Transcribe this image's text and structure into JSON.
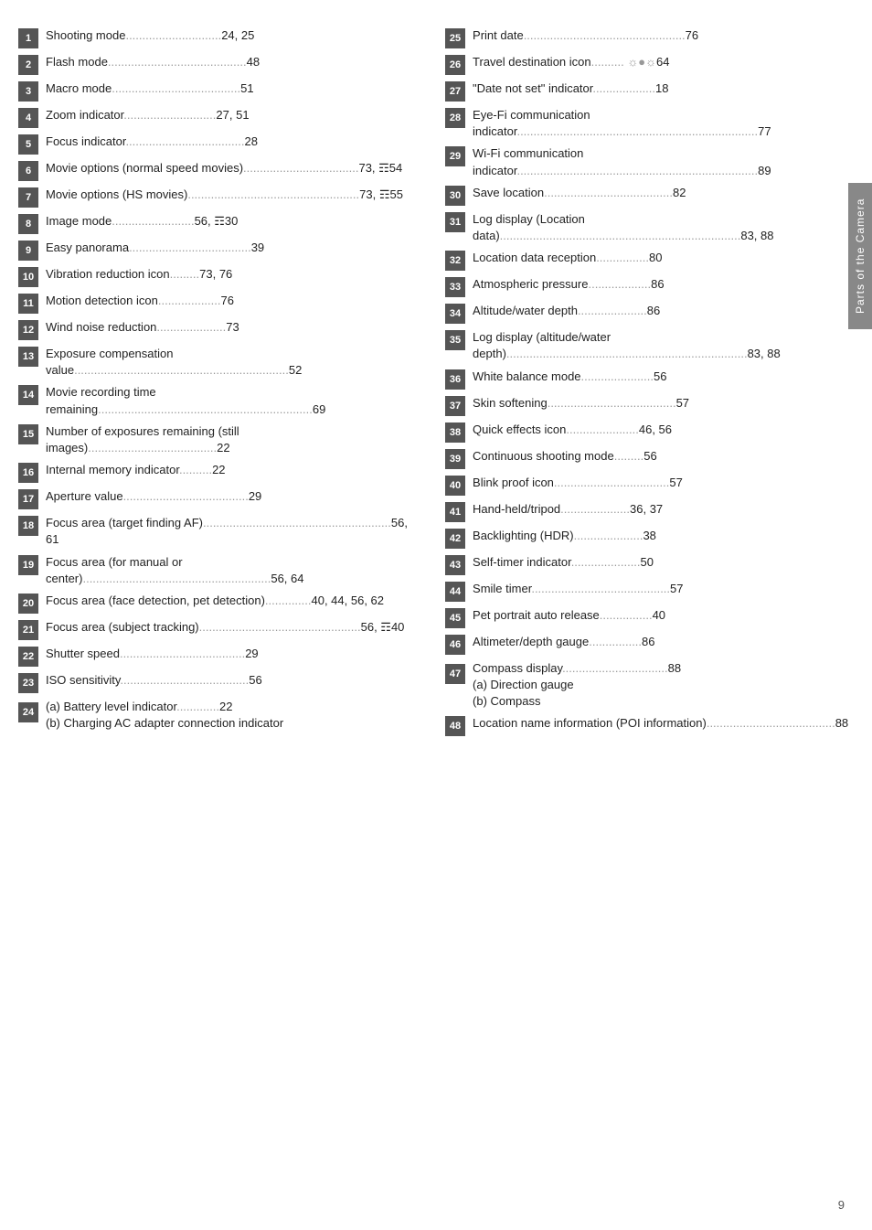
{
  "sidebar_label": "Parts of the Camera",
  "page_number": "9",
  "left_entries": [
    {
      "num": "1",
      "text": "Shooting mode",
      "dots": ".............................",
      "page": "24, 25"
    },
    {
      "num": "2",
      "text": "Flash mode",
      "dots": "..........................................",
      "page": "48"
    },
    {
      "num": "3",
      "text": "Macro mode",
      "dots": ".......................................",
      "page": "51"
    },
    {
      "num": "4",
      "text": "Zoom indicator",
      "dots": "............................",
      "page": "27, 51"
    },
    {
      "num": "5",
      "text": "Focus indicator",
      "dots": "....................................",
      "page": "28"
    },
    {
      "num": "6",
      "text": "Movie options (normal speed movies)",
      "dots": "...................................",
      "page": "73, ☶54"
    },
    {
      "num": "7",
      "text": "Movie options (HS movies)",
      "dots": "....................................................",
      "page": "73, ☶55"
    },
    {
      "num": "8",
      "text": "Image mode",
      "dots": ".........................",
      "page": "56, ☶30"
    },
    {
      "num": "9",
      "text": "Easy panorama",
      "dots": ".....................................",
      "page": "39"
    },
    {
      "num": "10",
      "text": "Vibration reduction icon",
      "dots": ".........",
      "page": "73, 76"
    },
    {
      "num": "11",
      "text": "Motion detection icon",
      "dots": "...................",
      "page": "76"
    },
    {
      "num": "12",
      "text": "Wind noise reduction",
      "dots": ".....................",
      "page": "73"
    },
    {
      "num": "13",
      "text": "Exposure compensation value",
      "dots": ".................................................................",
      "page": "52"
    },
    {
      "num": "14",
      "text": "Movie recording time remaining",
      "dots": ".................................................................",
      "page": "69"
    },
    {
      "num": "15",
      "text": "Number of exposures remaining (still images)",
      "dots": ".......................................",
      "page": "22"
    },
    {
      "num": "16",
      "text": "Internal memory indicator",
      "dots": "..........",
      "page": "22"
    },
    {
      "num": "17",
      "text": "Aperture value",
      "dots": "......................................",
      "page": "29"
    },
    {
      "num": "18",
      "text": "Focus area (target finding AF)",
      "dots": ".........................................................",
      "page": "56, 61"
    },
    {
      "num": "19",
      "text": "Focus area (for manual or center)",
      "dots": ".........................................................",
      "page": "56, 64"
    },
    {
      "num": "20",
      "text": "Focus area (face detection, pet detection)",
      "dots": "..............",
      "page": "40, 44, 56, 62"
    },
    {
      "num": "21",
      "text": "Focus area (subject tracking)",
      "dots": ".................................................",
      "page": "56, ☶40"
    },
    {
      "num": "22",
      "text": "Shutter speed",
      "dots": "......................................",
      "page": "29"
    },
    {
      "num": "23",
      "text": "ISO sensitivity",
      "dots": ".......................................",
      "page": "56"
    },
    {
      "num": "24",
      "text": "(a) Battery level indicator ............. 22\n(b) Charging AC adapter connection indicator",
      "dots": "",
      "page": ""
    }
  ],
  "right_entries": [
    {
      "num": "25",
      "text": "Print date",
      "dots": ".................................................",
      "page": "76"
    },
    {
      "num": "26",
      "text": "Travel destination icon",
      "dots": ".......... ☼●☼",
      "page": "64"
    },
    {
      "num": "27",
      "text": "\"Date not set\" indicator",
      "dots": "...................",
      "page": "18"
    },
    {
      "num": "28",
      "text": "Eye-Fi communication indicator",
      "dots": ".........................................................................",
      "page": "77"
    },
    {
      "num": "29",
      "text": "Wi-Fi communication indicator",
      "dots": ".........................................................................",
      "page": "89"
    },
    {
      "num": "30",
      "text": "Save location",
      "dots": ".......................................",
      "page": "82"
    },
    {
      "num": "31",
      "text": "Log display (Location data)",
      "dots": ".........................................................................",
      "page": "83, 88"
    },
    {
      "num": "32",
      "text": "Location data reception",
      "dots": "................",
      "page": "80"
    },
    {
      "num": "33",
      "text": "Atmospheric pressure",
      "dots": "...................",
      "page": "86"
    },
    {
      "num": "34",
      "text": "Altitude/water depth",
      "dots": ".....................",
      "page": "86"
    },
    {
      "num": "35",
      "text": "Log display (altitude/water depth)",
      "dots": ".........................................................................",
      "page": "83, 88"
    },
    {
      "num": "36",
      "text": "White balance mode",
      "dots": "......................",
      "page": "56"
    },
    {
      "num": "37",
      "text": "Skin softening",
      "dots": ".......................................",
      "page": "57"
    },
    {
      "num": "38",
      "text": "Quick effects icon",
      "dots": "......................",
      "page": "46, 56"
    },
    {
      "num": "39",
      "text": "Continuous shooting mode",
      "dots": ".........",
      "page": "56"
    },
    {
      "num": "40",
      "text": "Blink proof icon",
      "dots": "...................................",
      "page": "57"
    },
    {
      "num": "41",
      "text": "Hand-held/tripod",
      "dots": ".....................",
      "page": "36, 37"
    },
    {
      "num": "42",
      "text": "Backlighting (HDR)",
      "dots": ".....................",
      "page": "38"
    },
    {
      "num": "43",
      "text": "Self-timer indicator",
      "dots": ".....................",
      "page": "50"
    },
    {
      "num": "44",
      "text": "Smile timer",
      "dots": "..........................................",
      "page": "57"
    },
    {
      "num": "45",
      "text": "Pet portrait auto release",
      "dots": "................",
      "page": "40"
    },
    {
      "num": "46",
      "text": "Altimeter/depth gauge",
      "dots": "................",
      "page": "86"
    },
    {
      "num": "47",
      "text": "Compass display ................................88\n(a) Direction gauge\n(b) Compass",
      "dots": "",
      "page": ""
    },
    {
      "num": "48",
      "text": "Location name information (POI information)",
      "dots": ".......................................",
      "page": "88"
    }
  ]
}
